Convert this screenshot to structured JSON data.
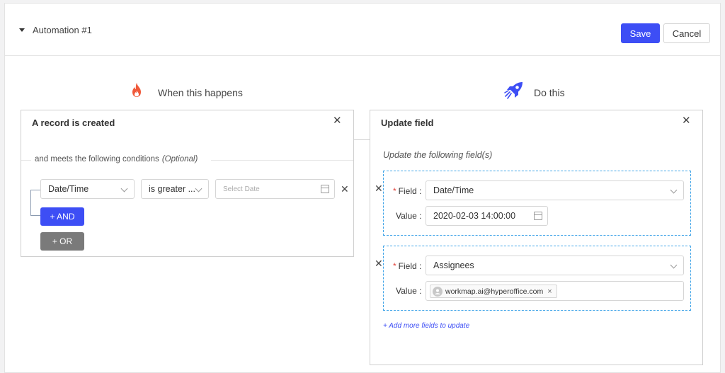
{
  "header": {
    "title": "Automation #1",
    "save_label": "Save",
    "cancel_label": "Cancel"
  },
  "trigger": {
    "section_title": "When this happens",
    "panel_title": "A record is created",
    "conditions_label": "and meets the following conditions",
    "conditions_optional": "(Optional)",
    "condition": {
      "field": "Date/Time",
      "operator": "is greater ...",
      "value_placeholder": "Select Date"
    },
    "and_label": "+ AND",
    "or_label": "+ OR"
  },
  "action": {
    "section_title": "Do this",
    "panel_title": "Update field",
    "subtitle": "Update the following field(s)",
    "fields": [
      {
        "field_label": "Field :",
        "field_value": "Date/Time",
        "value_label": "Value :",
        "value": "2020-02-03 14:00:00"
      },
      {
        "field_label": "Field :",
        "field_value": "Assignees",
        "value_label": "Value :",
        "chip": "workmap.ai@hyperoffice.com"
      }
    ],
    "add_more_label": "+ Add more fields to update"
  },
  "icons": {
    "trigger_icon": "fire-icon",
    "action_icon": "rocket-icon"
  },
  "colors": {
    "primary": "#3d4ef5",
    "or_button": "#7a7a7a",
    "dashed_border": "#42a5e8",
    "required": "#e2463e"
  }
}
